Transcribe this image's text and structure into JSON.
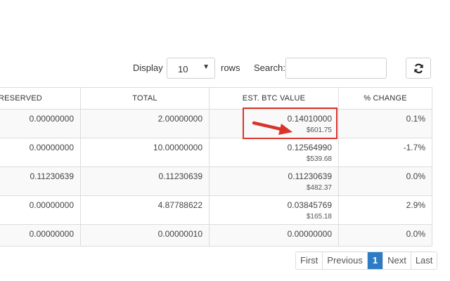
{
  "controls": {
    "display_label": "Display",
    "rows_value": "10",
    "rows_label": "rows",
    "search_label": "Search:",
    "search_value": "",
    "refresh_icon": "refresh-icon"
  },
  "table": {
    "headers": {
      "reserved": "RESERVED",
      "total": "TOTAL",
      "btc_value": "EST. BTC VALUE",
      "change": "% CHANGE"
    },
    "rows": [
      {
        "reserved": "0.00000000",
        "total": "2.00000000",
        "btc": "0.14010000",
        "usd": "$601.75",
        "change": "0.1%"
      },
      {
        "reserved": "0.00000000",
        "total": "10.00000000",
        "btc": "0.12564990",
        "usd": "$539.68",
        "change": "-1.7%"
      },
      {
        "reserved": "0.11230639",
        "total": "0.11230639",
        "btc": "0.11230639",
        "usd": "$482.37",
        "change": "0.0%"
      },
      {
        "reserved": "0.00000000",
        "total": "4.87788622",
        "btc": "0.03845769",
        "usd": "$165.18",
        "change": "2.9%"
      },
      {
        "reserved": "0.00000000",
        "total": "0.00000010",
        "btc": "0.00000000",
        "usd": "",
        "change": "0.0%"
      }
    ]
  },
  "pagination": {
    "first": "First",
    "previous": "Previous",
    "current": "1",
    "next": "Next",
    "last": "Last"
  },
  "colors": {
    "highlight": "#d9342b",
    "active_page": "#2d7bc4"
  }
}
